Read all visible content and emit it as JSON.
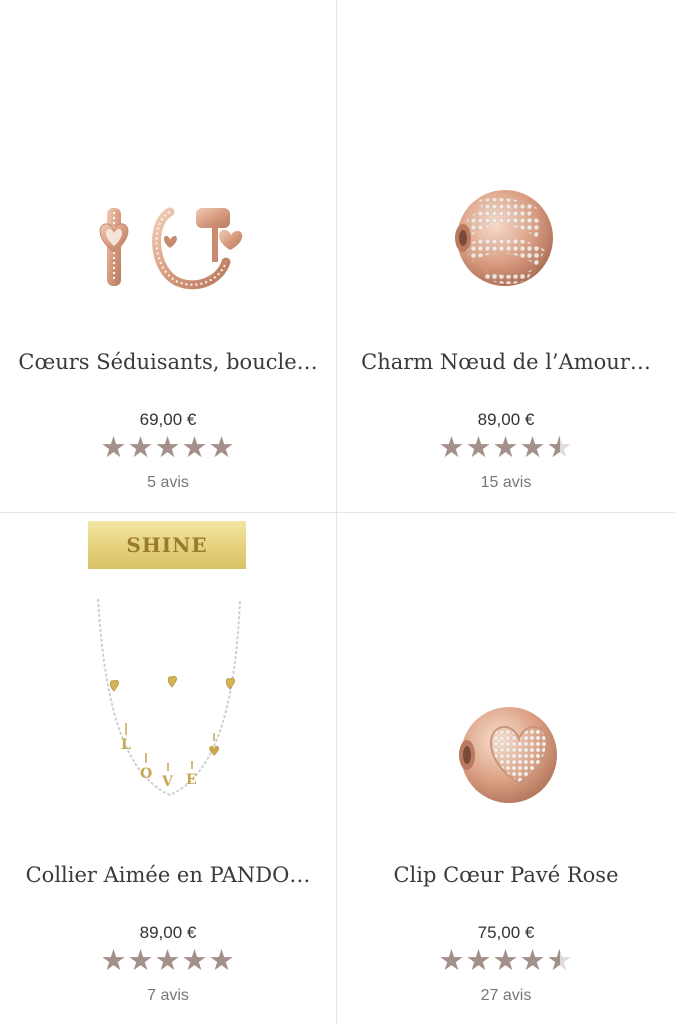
{
  "products": [
    {
      "title": "Cœurs Séduisants, boucle…",
      "price": "69,00 €",
      "rating": 5,
      "reviews": "5 avis",
      "image_icon": "heart-hoop-earrings-icon"
    },
    {
      "title": "Charm Nœud de l’Amour…",
      "price": "89,00 €",
      "rating": 4.5,
      "reviews": "15 avis",
      "image_icon": "love-knot-charm-icon"
    },
    {
      "title": "Collier Aimée en PANDO…",
      "price": "89,00 €",
      "rating": 5,
      "reviews": "7 avis",
      "badge": "SHINE",
      "image_icon": "love-necklace-icon"
    },
    {
      "title": "Clip Cœur Pavé Rose",
      "price": "75,00 €",
      "rating": 4.5,
      "reviews": "27 avis",
      "image_icon": "pave-heart-clip-icon"
    }
  ],
  "colors": {
    "star_filled": "#a3908a",
    "star_empty": "#e2dad6",
    "rose_gold": "#d9a58a",
    "badge_gold": "#e5d17b"
  }
}
